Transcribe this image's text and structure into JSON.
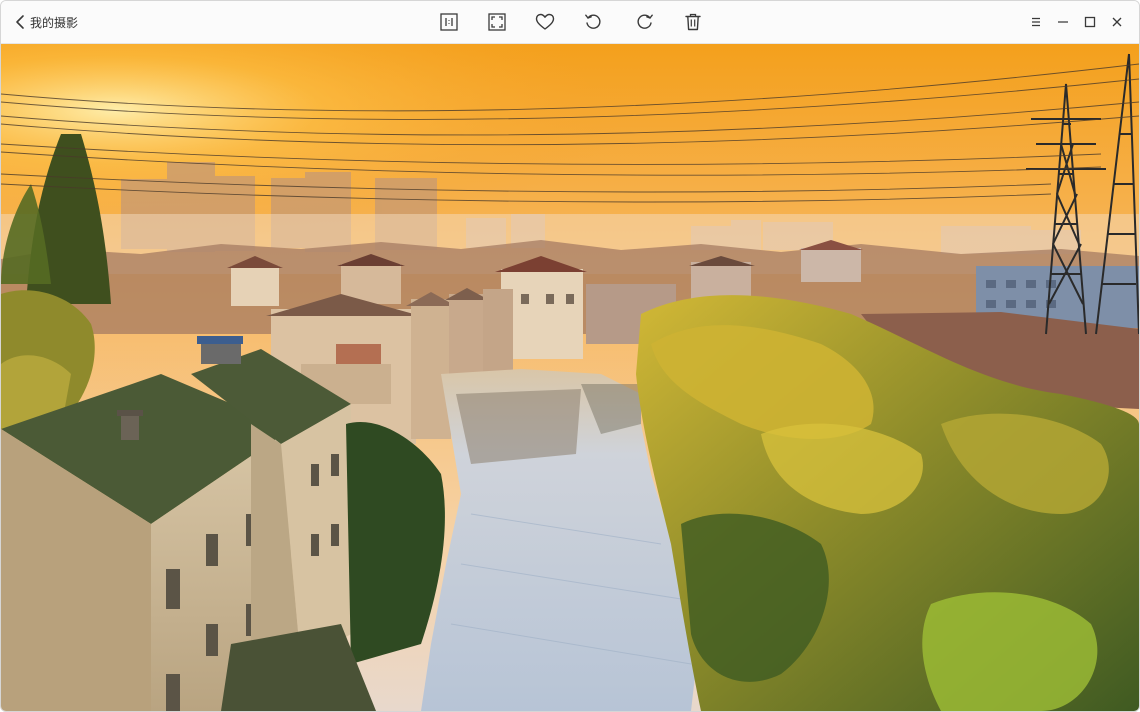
{
  "header": {
    "back_label": "我的摄影"
  },
  "toolbar": {
    "items": [
      {
        "name": "actual-size-icon"
      },
      {
        "name": "fit-screen-icon"
      },
      {
        "name": "favorite-heart-icon"
      },
      {
        "name": "rotate-left-icon"
      },
      {
        "name": "rotate-right-icon"
      },
      {
        "name": "trash-icon"
      }
    ]
  },
  "window_controls": {
    "items": [
      {
        "name": "menu-icon"
      },
      {
        "name": "minimize-icon"
      },
      {
        "name": "maximize-icon"
      },
      {
        "name": "close-icon"
      }
    ]
  },
  "colors": {
    "icon": "#3a3a3a",
    "titlebar_bg": "#fbfbfb",
    "sky_top": "#f5a623",
    "sky_bottom": "#f7d9b0",
    "water": "#c9d3e0",
    "foliage_yellow": "#c4b530",
    "foliage_green": "#4f6b2a"
  }
}
